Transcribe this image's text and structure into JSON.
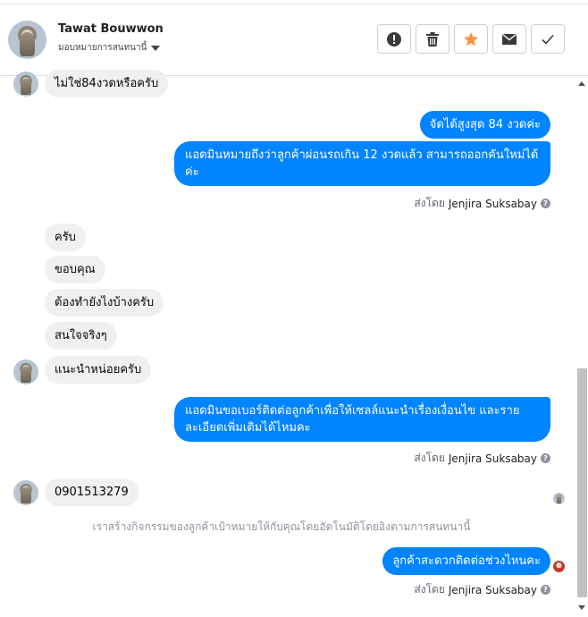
{
  "header": {
    "name": "Tawat Bouwwon",
    "subtitle": "มอบหมายการสนทนานี้"
  },
  "toolbar": [
    {
      "name": "report-spam-button",
      "icon": "exclamation-icon"
    },
    {
      "name": "delete-button",
      "icon": "trash-icon"
    },
    {
      "name": "star-button",
      "icon": "star-icon"
    },
    {
      "name": "mark-unread-button",
      "icon": "envelope-icon"
    },
    {
      "name": "mark-done-button",
      "icon": "checkmark-icon"
    }
  ],
  "messages": {
    "m1": "ไม่ใช่84งวดหรือครับ",
    "m2": "จัดได้สูงสุด 84 งวดค่ะ",
    "m3": "แอดมินหมายถึงว่าลูกค้าผ่อนรถเกิน 12 งวดแล้ว สามารถออกคันใหม่ได้ค่ะ",
    "m4": "ครับ",
    "m5": "ขอบคุณ",
    "m6": "ต้องทำยังไงบ้างครับ",
    "m7": "สนใจจริงๆ",
    "m8": "แนะนำหน่อยครับ",
    "m9": "แอดมินขอเบอร์ติดต่อลูกค้าเพื่อให้เซลล์แนะนำเรื่องเงื่อนไข และรายละเอียดเพิ่มเติมได้ไหมคะ",
    "m10": "0901513279",
    "m11": "ลูกค้าสะดวกติดต่อช่วงไหนคะ"
  },
  "sent_by": {
    "prefix": "ส่งโดย",
    "agent": "Jenjira Suksabay"
  },
  "notice": "เราสร้างกิจกรรมของลูกค้าเป้าหมายให้กับคุณโดยอัตโนมัติโดยอิงตามการสนทนานี้",
  "colors": {
    "outgoing": "#0084ff",
    "incoming": "#f0f0f0",
    "star": "#f7923b"
  }
}
